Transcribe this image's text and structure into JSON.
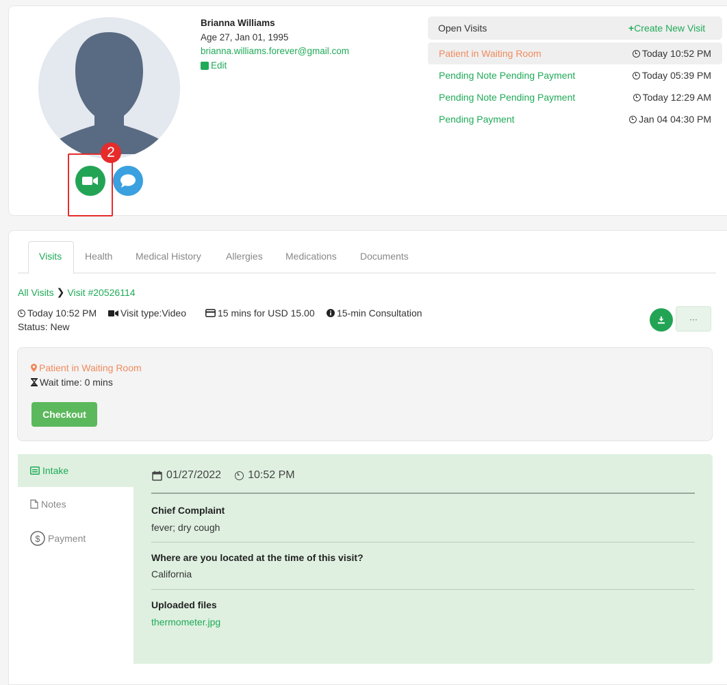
{
  "patient": {
    "name": "Brianna Williams",
    "age_dob": "Age 27, Jan 01, 1995",
    "email": "brianna.williams.forever@gmail.com",
    "edit_label": "Edit"
  },
  "step_badge": "2",
  "open_visits": {
    "title": "Open Visits",
    "create_label": "Create New Visit",
    "items": [
      {
        "status": "Patient in Waiting Room",
        "time": "Today 10:52 PM"
      },
      {
        "status": "Pending Note Pending Payment",
        "time": "Today 05:39 PM"
      },
      {
        "status": "Pending Note Pending Payment",
        "time": "Today 12:29 AM"
      },
      {
        "status": "Pending Payment",
        "time": "Jan 04 04:30 PM"
      }
    ]
  },
  "tabs": [
    "Visits",
    "Health",
    "Medical History",
    "Allergies",
    "Medications",
    "Documents"
  ],
  "breadcrumb": {
    "root": "All Visits",
    "current": "Visit #20526114"
  },
  "visit": {
    "time": "Today 10:52 PM",
    "type": "Visit type:Video",
    "price": "15 mins for USD 15.00",
    "service": "15-min Consultation",
    "status": "Status: New",
    "more_label": "···"
  },
  "waiting": {
    "status": "Patient in Waiting Room",
    "wait_time": "Wait time: 0 mins",
    "checkout_label": "Checkout"
  },
  "side_tabs": [
    "Intake",
    "Notes",
    "Payment"
  ],
  "intake": {
    "date": "01/27/2022",
    "time": "10:52 PM",
    "items": [
      {
        "label": "Chief Complaint",
        "value": "fever; dry cough"
      },
      {
        "label": "Where are you located at the time of this visit?",
        "value": "California"
      },
      {
        "label": "Uploaded files",
        "value": "thermometer.jpg"
      }
    ]
  },
  "colors": {
    "accent": "#1faa58",
    "waiting_orange": "#f08a5d",
    "highlight_red": "#e62b2b",
    "chat_blue": "#3aa0df"
  }
}
